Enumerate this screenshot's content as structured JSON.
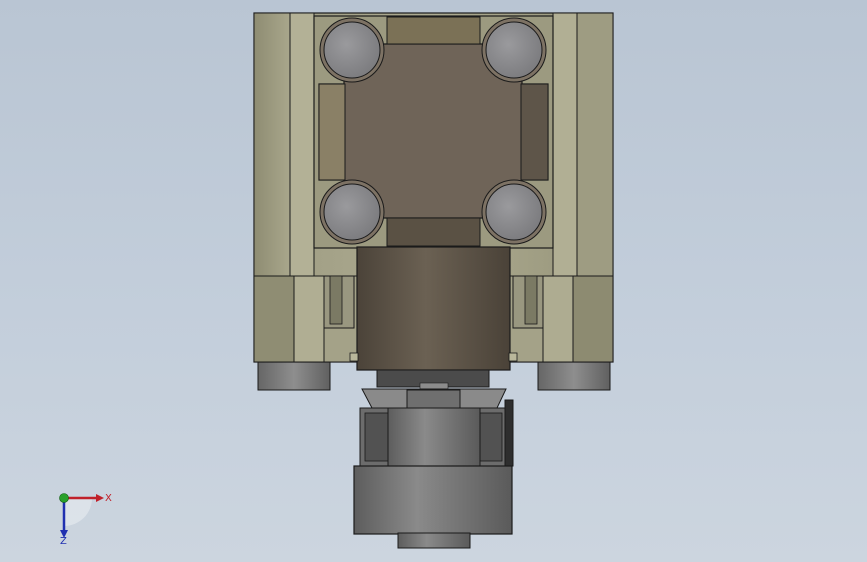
{
  "view": {
    "background_top": "#b9c5d3",
    "background_bottom": "#ccd5df"
  },
  "model": {
    "body_color": "#a6a489",
    "body_dark": "#8b8a70",
    "body_shadow": "#6e6d58",
    "bore_color": "#6f6458",
    "bolt_color": "#8c8c8f",
    "rod_color": "#5b5246",
    "fitting_color": "#7d7d7d",
    "fitting_dark": "#505050",
    "edge_color": "#1a1a1a"
  },
  "triad": {
    "x_label": "X",
    "z_label": "Z",
    "x_color": "#c0202a",
    "y_color": "#2aa02a",
    "z_color": "#2030b0"
  }
}
